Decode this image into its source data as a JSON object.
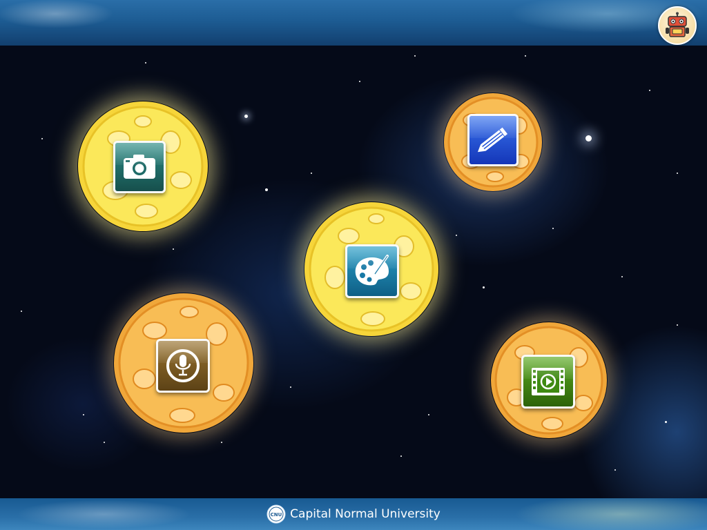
{
  "header": {
    "robot_button_icon": "robot-icon"
  },
  "apps": [
    {
      "name": "camera",
      "icon": "camera-icon",
      "color": "#1f6b68",
      "planet": "yellow"
    },
    {
      "name": "draw",
      "icon": "pencil-icon",
      "color": "#1c4fd6",
      "planet": "orange"
    },
    {
      "name": "paint",
      "icon": "palette-icon",
      "color": "#1779a6",
      "planet": "yellow"
    },
    {
      "name": "record",
      "icon": "microphone-icon",
      "color": "#7a5a22",
      "planet": "orange"
    },
    {
      "name": "video",
      "icon": "film-play-icon",
      "color": "#3f8a12",
      "planet": "orange"
    }
  ],
  "footer": {
    "logo_text": "CNU",
    "institution": "Capital Normal University"
  },
  "colors": {
    "planet_yellow": "#f7e24a",
    "planet_orange": "#f6b545",
    "band_blue": "#1d5c93"
  }
}
